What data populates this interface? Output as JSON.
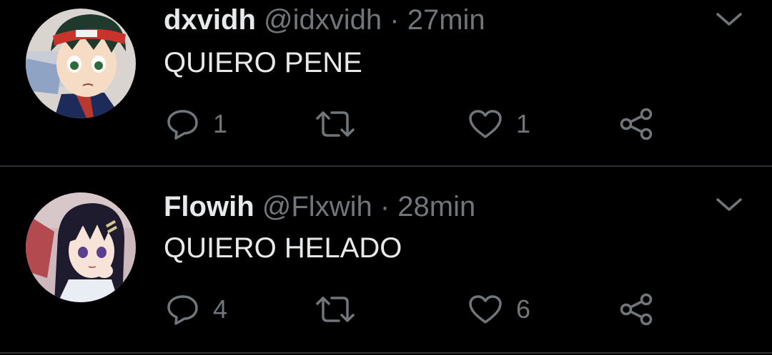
{
  "tweets": [
    {
      "name": "dxvidh",
      "handle": "@idxvidh",
      "separator": "·",
      "time": "27min",
      "text": "QUIERO PENE",
      "replies": "1",
      "retweets": "",
      "likes": "1",
      "avatar": "anime-boy-avatar"
    },
    {
      "name": "Flowih",
      "handle": "@Flxwih",
      "separator": "·",
      "time": "28min",
      "text": "QUIERO HELADO",
      "replies": "4",
      "retweets": "",
      "likes": "6",
      "avatar": "anime-girl-avatar"
    }
  ],
  "colors": {
    "background": "#000000",
    "text": "#e7e9ea",
    "muted": "#71767b",
    "divider": "#2f3336"
  }
}
